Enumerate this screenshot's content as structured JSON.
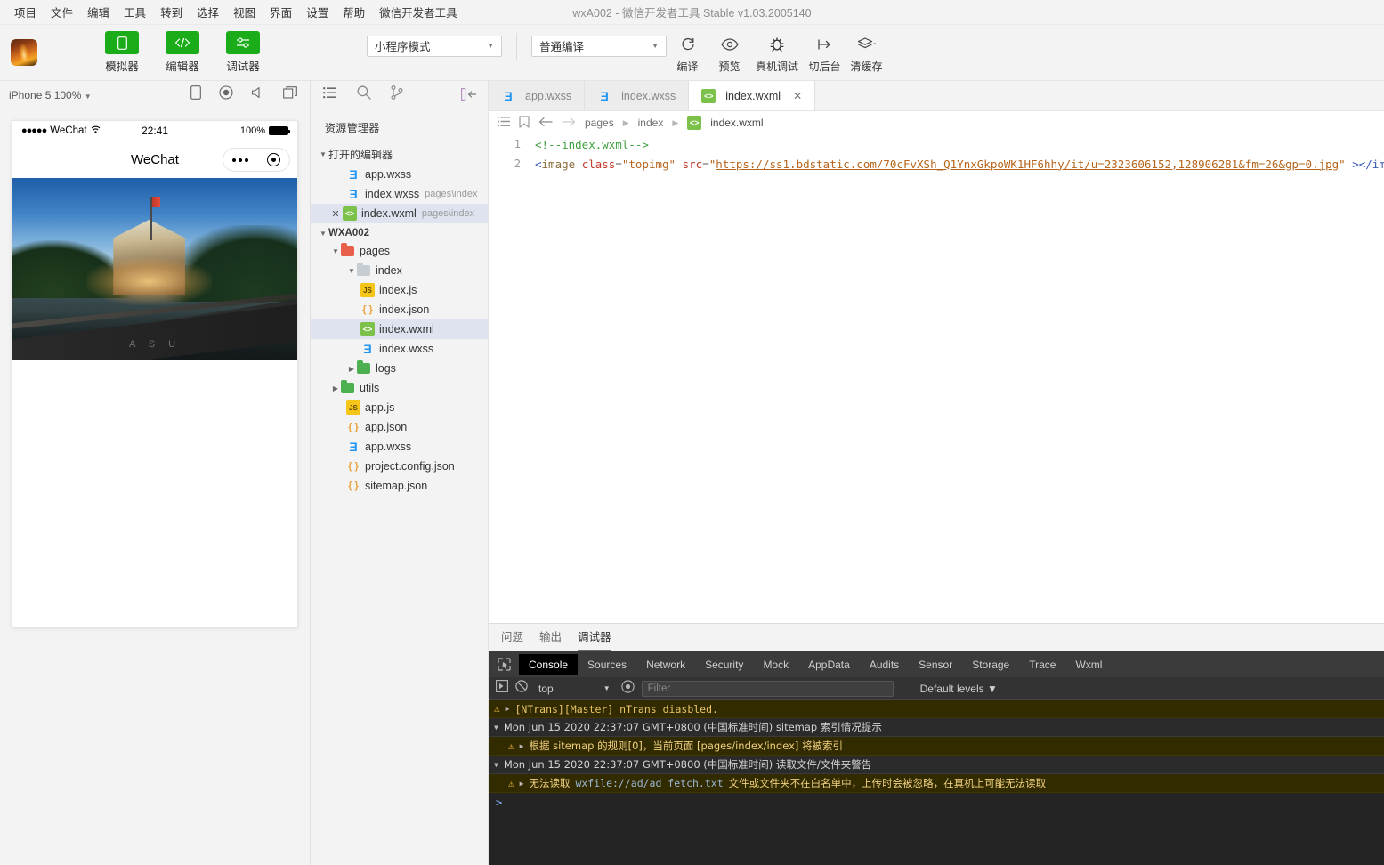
{
  "menubar": {
    "items": [
      "项目",
      "文件",
      "编辑",
      "工具",
      "转到",
      "选择",
      "视图",
      "界面",
      "设置",
      "帮助",
      "微信开发者工具"
    ],
    "window_title": "wxA002 - 微信开发者工具 Stable v1.03.2005140"
  },
  "toolbar": {
    "mode_buttons": [
      {
        "label": "模拟器",
        "icon": "phone-icon"
      },
      {
        "label": "编辑器",
        "icon": "code-icon"
      },
      {
        "label": "调试器",
        "icon": "debug-icon"
      }
    ],
    "mode_select": "小程序模式",
    "compile_select": "普通编译",
    "actions": [
      {
        "label": "编译",
        "icon": "refresh-icon"
      },
      {
        "label": "预览",
        "icon": "eye-icon"
      },
      {
        "label": "真机调试",
        "icon": "bug-icon"
      },
      {
        "label": "切后台",
        "icon": "background-icon"
      },
      {
        "label": "清缓存",
        "icon": "layers-icon"
      }
    ],
    "accent_color": "#1aad19"
  },
  "simulator": {
    "device_label": "iPhone 5 100%",
    "toolbar_icons": [
      "rotate-icon",
      "record-icon",
      "sound-icon",
      "multiwindow-icon"
    ],
    "status_bar": {
      "carrier": "WeChat",
      "signal": "●●●●●",
      "time": "22:41",
      "battery": "100%"
    },
    "nav_title": "WeChat",
    "image_watermark": "A S U"
  },
  "explorer": {
    "sidebar_icons": [
      "files-icon",
      "search-icon",
      "source-control-icon",
      "collapse-panel-icon"
    ],
    "title": "资源管理器",
    "open_editors_label": "打开的编辑器",
    "open_editors": [
      {
        "name": "app.wxss",
        "path": "",
        "type": "css",
        "active": false
      },
      {
        "name": "index.wxss",
        "path": "pages\\index",
        "type": "css",
        "active": false
      },
      {
        "name": "index.wxml",
        "path": "pages\\index",
        "type": "wxml",
        "active": true
      }
    ],
    "project_label": "WXA002",
    "tree": [
      {
        "name": "pages",
        "type": "folder-pages",
        "indent": 2,
        "expanded": true
      },
      {
        "name": "index",
        "type": "folder-index",
        "indent": 3,
        "expanded": true
      },
      {
        "name": "index.js",
        "type": "js",
        "indent": 4
      },
      {
        "name": "index.json",
        "type": "json",
        "indent": 4
      },
      {
        "name": "index.wxml",
        "type": "wxml",
        "indent": 4,
        "active": true
      },
      {
        "name": "index.wxss",
        "type": "css",
        "indent": 4
      },
      {
        "name": "logs",
        "type": "folder-logs",
        "indent": 3,
        "expanded": false
      },
      {
        "name": "utils",
        "type": "folder-utils",
        "indent": 2,
        "expanded": false
      },
      {
        "name": "app.js",
        "type": "js",
        "indent": 2
      },
      {
        "name": "app.json",
        "type": "json",
        "indent": 2
      },
      {
        "name": "app.wxss",
        "type": "css",
        "indent": 2
      },
      {
        "name": "project.config.json",
        "type": "json",
        "indent": 2
      },
      {
        "name": "sitemap.json",
        "type": "json",
        "indent": 2
      }
    ]
  },
  "editor": {
    "tabs": [
      {
        "name": "app.wxss",
        "type": "css",
        "active": false,
        "closable": false
      },
      {
        "name": "index.wxss",
        "type": "css",
        "active": false,
        "closable": false
      },
      {
        "name": "index.wxml",
        "type": "wxml",
        "active": true,
        "closable": true
      }
    ],
    "breadcrumb": [
      "pages",
      "index",
      "index.wxml"
    ],
    "breadcrumb_icons": [
      "outline-icon",
      "bookmark-icon",
      "back-arrow-icon",
      "forward-arrow-icon"
    ],
    "lines": [
      {
        "number": "1",
        "comment": "<!--index.wxml-->"
      },
      {
        "number": "2",
        "open_punct": "<",
        "tag": "image",
        "attr1": "class",
        "value1": "\"topimg\"",
        "attr2": "src",
        "quote_open": "\"",
        "url": "https://ss1.bdstatic.com/70cFvXSh_Q1YnxGkpoWK1HF6hhy/it/u=2323606152,128906281&fm=26&gp=0.jpg",
        "quote_close": "\"",
        "close_tag": " ></image>"
      }
    ]
  },
  "panel": {
    "tabs": [
      "问题",
      "输出",
      "调试器"
    ],
    "active_tab": "调试器",
    "devtools_tabs": [
      "Console",
      "Sources",
      "Network",
      "Security",
      "Mock",
      "AppData",
      "Audits",
      "Sensor",
      "Storage",
      "Trace",
      "Wxml"
    ],
    "devtools_active": "Console",
    "context": "top",
    "filter_placeholder": "Filter",
    "levels_label": "Default levels",
    "logs": [
      {
        "kind": "warn",
        "text": "[NTrans][Master] nTrans diasbled."
      },
      {
        "kind": "group",
        "text": "Mon Jun 15 2020 22:37:07 GMT+0800 (中国标准时间) sitemap 索引情况提示"
      },
      {
        "kind": "warn-nested",
        "text": "根据 sitemap 的规则[0]，当前页面 [pages/index/index] 将被索引"
      },
      {
        "kind": "group",
        "text": "Mon Jun 15 2020 22:37:07 GMT+0800 (中国标准时间) 读取文件/文件夹警告"
      },
      {
        "kind": "warn-nested-link",
        "prefix": "无法读取 ",
        "link": "wxfile://ad/ad fetch.txt",
        "suffix": " 文件或文件夹不在白名单中，上传时会被忽略，在真机上可能无法读取"
      }
    ],
    "prompt": ">"
  }
}
